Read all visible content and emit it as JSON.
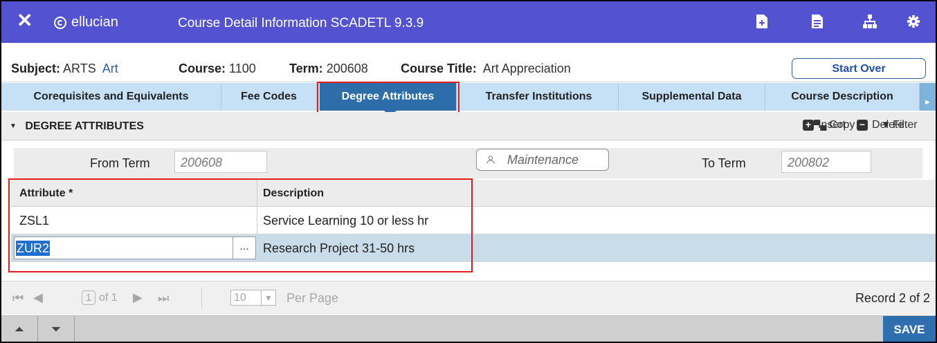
{
  "header": {
    "close_glyph": "✕",
    "brand": "ellucian",
    "title": "Course Detail Information SCADETL 9.3.9",
    "icons": [
      "add-page-icon",
      "related-icon",
      "sitemap-icon",
      "settings-icon"
    ]
  },
  "key_block": {
    "subject_label": "Subject:",
    "subject_value": "ARTS",
    "subject_desc": "Art",
    "course_label": "Course:",
    "course_value": "1100",
    "term_label": "Term:",
    "term_value": "200608",
    "title_label": "Course Title:",
    "title_value": "Art Appreciation",
    "start_over": "Start Over"
  },
  "tabs": [
    {
      "label": "Corequisites and Equivalents"
    },
    {
      "label": "Fee Codes"
    },
    {
      "label": "Degree Attributes",
      "active": true
    },
    {
      "label": "Transfer Institutions"
    },
    {
      "label": "Supplemental Data"
    },
    {
      "label": "Course Description"
    }
  ],
  "section": {
    "title": "DEGREE ATTRIBUTES",
    "insert": "Insert",
    "delete": "Delete",
    "copy": "Copy",
    "filter": "Filter"
  },
  "term_row": {
    "from_label": "From Term",
    "from_value": "200608",
    "maintenance": "Maintenance",
    "to_label": "To Term",
    "to_value": "200802"
  },
  "grid": {
    "col_attribute": "Attribute *",
    "col_description": "Description",
    "rows": [
      {
        "attribute": "ZSL1",
        "description": "Service Learning 10 or less hr"
      },
      {
        "attribute": "ZUR2",
        "description": "Research Project 31-50 hrs",
        "selected": true
      }
    ],
    "ellipsis": "..."
  },
  "pager": {
    "page": "1",
    "of": "of 1",
    "per_page_value": "10",
    "per_page_label": "Per Page",
    "record": "Record 2 of 2"
  },
  "footer": {
    "save": "SAVE"
  },
  "colors": {
    "header_bg": "#5353d1",
    "tab_bg": "#c6e0f5",
    "tab_active": "#2d6ea8",
    "highlight_red": "#e41b1b",
    "selected_row": "#c9dcea",
    "save_bg": "#2e6fb0"
  }
}
